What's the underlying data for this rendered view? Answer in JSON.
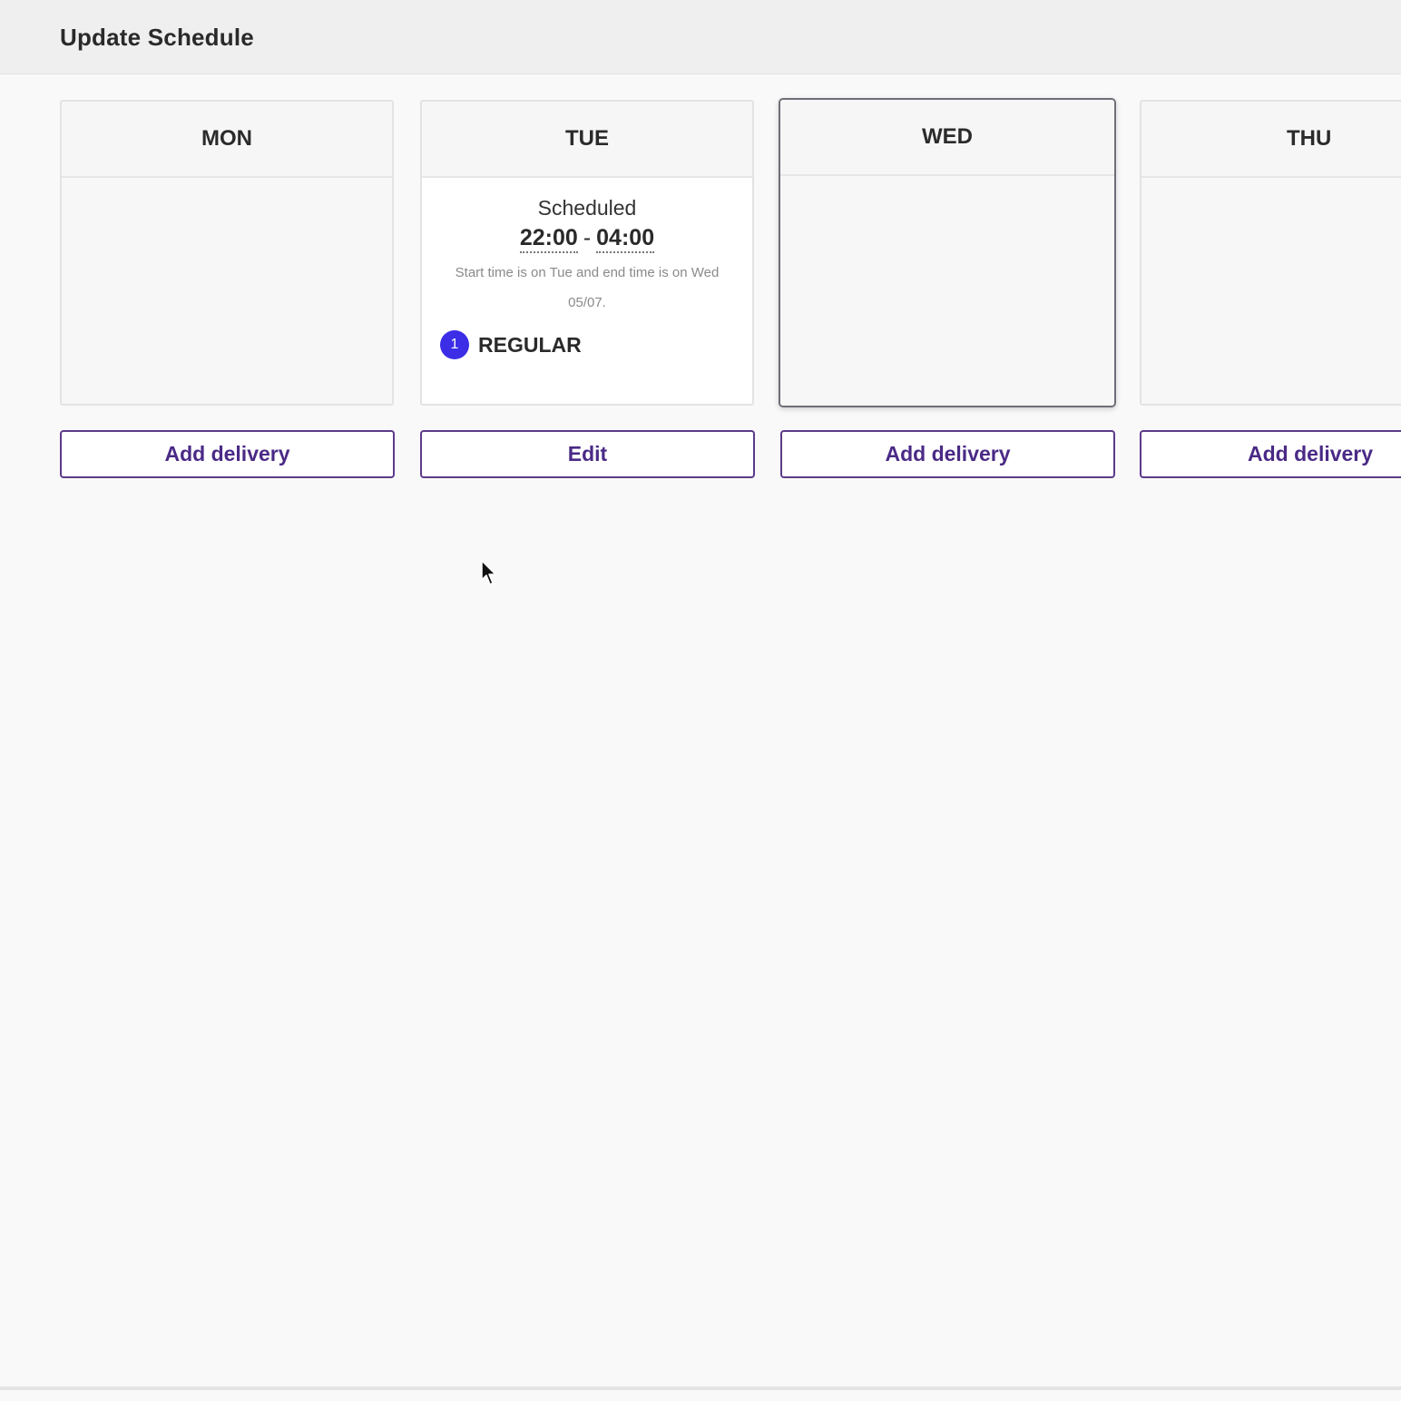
{
  "header": {
    "title": "Update Schedule"
  },
  "days": [
    {
      "label": "MON",
      "button": "Add delivery"
    },
    {
      "label": "TUE",
      "button": "Edit",
      "schedule": {
        "status": "Scheduled",
        "start": "22:00",
        "separator": "-",
        "end": "04:00",
        "note": "Start time is on Tue and end time is on Wed 05/07.",
        "badge_count": "1",
        "badge_label": "REGULAR"
      }
    },
    {
      "label": "WED",
      "button": "Add delivery"
    },
    {
      "label": "THU",
      "button": "Add delivery"
    }
  ],
  "colors": {
    "accent": "#4a2a86",
    "badge": "#3b2ee6",
    "selected_border": "#6e6e78"
  },
  "icons": {
    "cursor": "mouse-pointer-icon"
  }
}
